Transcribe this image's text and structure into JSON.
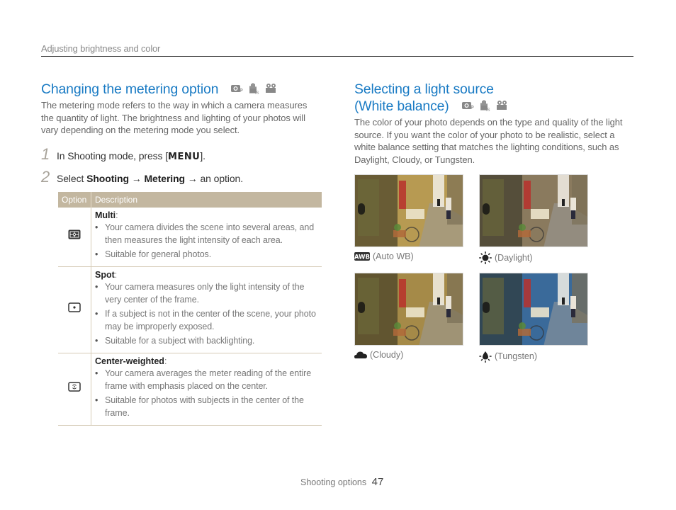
{
  "header": {
    "breadcrumb": "Adjusting brightness and color"
  },
  "metering": {
    "title": "Changing the metering option",
    "mode_icons": [
      "program-mode-icon",
      "dual-is-mode-icon",
      "movie-mode-icon"
    ],
    "intro": "The metering mode refers to the way in which a camera measures the quantity of light. The brightness and lighting of your photos will vary depending on the metering mode you select.",
    "steps": [
      {
        "num": "1",
        "prefix": "In Shooting mode, press [",
        "key": "MENU",
        "suffix": "]."
      },
      {
        "num": "2",
        "prefix": "Select ",
        "b1": "Shooting",
        "arrow1": " → ",
        "b2": "Metering",
        "arrow2": " → ",
        "suffix": "an option."
      }
    ],
    "table": {
      "headers": {
        "option": "Option",
        "description": "Description"
      },
      "rows": [
        {
          "icon": "multi-metering-icon",
          "name": "Multi",
          "bullets": [
            "Your camera divides the scene into several areas, and then measures the light intensity of each area.",
            "Suitable for general photos."
          ]
        },
        {
          "icon": "spot-metering-icon",
          "name": "Spot",
          "bullets": [
            "Your camera measures only the light intensity of the very center of the frame.",
            "If a subject is not in the center of the scene, your photo may be improperly exposed.",
            "Suitable for a subject with backlighting."
          ]
        },
        {
          "icon": "center-weighted-metering-icon",
          "name": "Center-weighted",
          "bullets": [
            "Your camera averages the meter reading of the entire frame with emphasis placed on the center.",
            "Suitable for photos with subjects in the center of the frame."
          ]
        }
      ]
    }
  },
  "white_balance": {
    "title_line1": "Selecting a light source",
    "title_line2": "(White balance)",
    "mode_icons": [
      "program-mode-icon",
      "dual-is-mode-icon",
      "movie-mode-icon"
    ],
    "intro": "The color of your photo depends on the type and quality of the light source. If you want the color of your photo to be realistic, select a white balance setting that matches the lighting conditions, such as Daylight, Cloudy, or Tungsten.",
    "samples": [
      {
        "icon": "auto-wb-icon",
        "label": "(Auto WB)",
        "tint": "#b79a52"
      },
      {
        "icon": "daylight-icon",
        "label": "(Daylight)",
        "tint": "#8a7a5e"
      },
      {
        "icon": "cloudy-icon",
        "label": "(Cloudy)",
        "tint": "#a58a48"
      },
      {
        "icon": "tungsten-icon",
        "label": "(Tungsten)",
        "tint": "#3a6a9a"
      }
    ]
  },
  "footer": {
    "section": "Shooting options",
    "page": "47"
  }
}
